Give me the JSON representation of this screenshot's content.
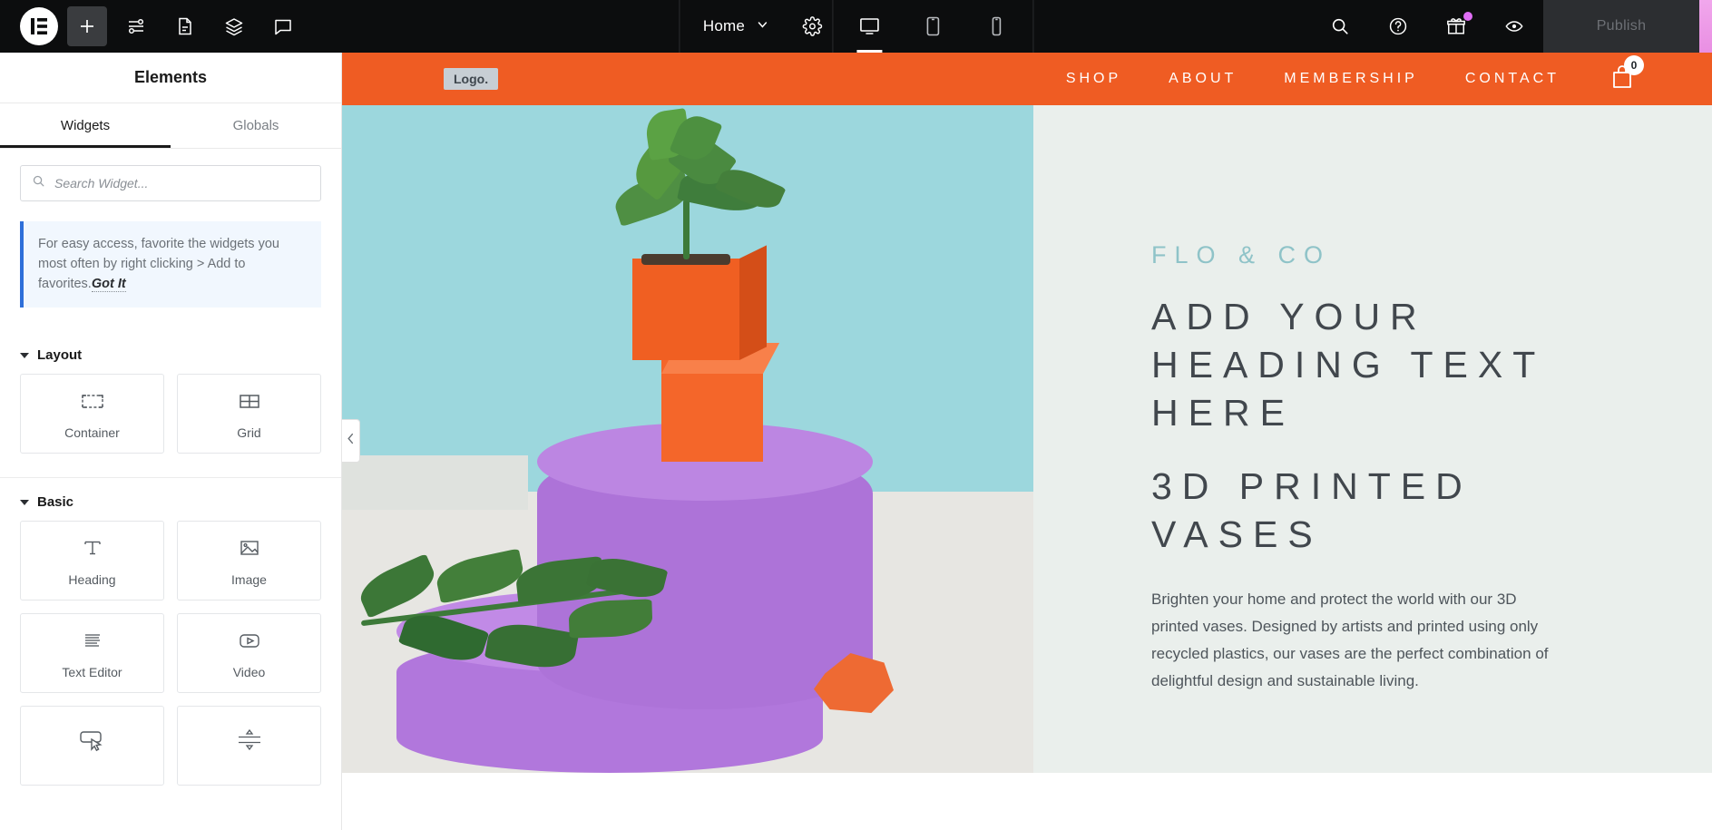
{
  "topbar": {
    "logo_icon": "elementor-logo-icon",
    "add_icon": "plus-icon",
    "settings_icon": "sliders-icon",
    "document_icon": "document-icon",
    "layers_icon": "layers-icon",
    "feedback_icon": "chat-bubble-icon",
    "page_name": "Home",
    "page_caret_icon": "chevron-down-icon",
    "site_settings_icon": "gear-icon",
    "devices": [
      {
        "name": "desktop",
        "icon": "desktop-icon",
        "active": true
      },
      {
        "name": "tablet",
        "icon": "tablet-icon",
        "active": false
      },
      {
        "name": "mobile",
        "icon": "mobile-icon",
        "active": false
      }
    ],
    "search_icon": "search-icon",
    "help_icon": "question-circle-icon",
    "gift_icon": "gift-icon",
    "gift_has_notification": true,
    "preview_icon": "eye-icon",
    "publish_label": "Publish"
  },
  "sidebar": {
    "title": "Elements",
    "tabs": [
      {
        "label": "Widgets",
        "active": true
      },
      {
        "label": "Globals",
        "active": false
      }
    ],
    "search": {
      "placeholder": "Search Widget...",
      "value": "",
      "icon": "search-icon"
    },
    "notice": {
      "text": "For easy access, favorite the widgets you most often by right clicking > Add to favorites.",
      "action_label": "Got It",
      "accent_color": "#2e6fd9"
    },
    "categories": [
      {
        "title": "Layout",
        "expanded": true,
        "widgets": [
          {
            "label": "Container",
            "icon": "container-icon"
          },
          {
            "label": "Grid",
            "icon": "grid-icon"
          }
        ]
      },
      {
        "title": "Basic",
        "expanded": true,
        "widgets": [
          {
            "label": "Heading",
            "icon": "heading-t-icon"
          },
          {
            "label": "Image",
            "icon": "image-icon"
          },
          {
            "label": "Text Editor",
            "icon": "text-editor-icon"
          },
          {
            "label": "Video",
            "icon": "video-play-icon"
          },
          {
            "label": "",
            "icon": "button-icon"
          },
          {
            "label": "",
            "icon": "divider-icon"
          }
        ]
      }
    ],
    "collapse_icon": "chevron-left-icon"
  },
  "canvas": {
    "site_nav": {
      "logo_text": "Logo.",
      "background_color": "#ef5c23",
      "links": [
        "SHOP",
        "ABOUT",
        "MEMBERSHIP",
        "CONTACT"
      ],
      "cart_icon": "shopping-bag-icon",
      "cart_count": "0"
    },
    "hero": {
      "eyebrow": "FLO & CO",
      "heading": "ADD YOUR HEADING TEXT HERE",
      "subheading": "3D PRINTED VASES",
      "paragraph": "Brighten your home and protect the world with our 3D printed vases. Designed by artists and printed using only recycled plastics, our vases are the perfect combination of delightful design and sustainable living.",
      "eyebrow_color": "#8fc3c8",
      "heading_color": "#41474d",
      "background_color": "#eaefec"
    }
  }
}
